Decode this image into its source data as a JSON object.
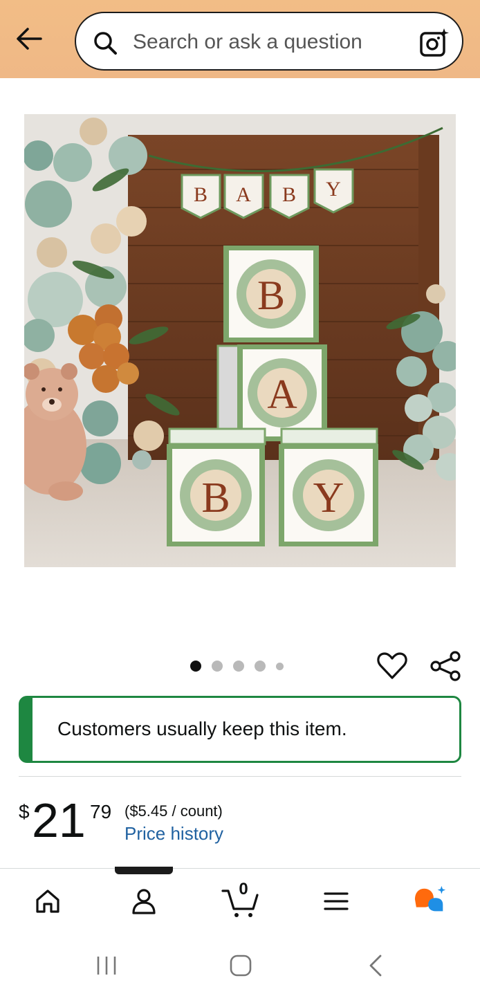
{
  "header": {
    "search_placeholder": "Search or ask a question"
  },
  "carousel": {
    "dot_count": 5,
    "active_index": 0
  },
  "notice": {
    "text": "Customers usually keep this item.",
    "accent_color": "#1e8741"
  },
  "price": {
    "currency": "$",
    "whole": "21",
    "fraction": "79",
    "unit_price": "($5.45 / count)",
    "history_link": "Price history"
  },
  "bottom_nav": {
    "cart_count": "0",
    "items": [
      "home-icon",
      "account-icon",
      "cart-icon",
      "menu-icon",
      "rufus-ai-icon"
    ]
  },
  "product_image": {
    "banner_letters": [
      "B",
      "A",
      "B",
      "Y"
    ],
    "box_letters": [
      "B",
      "A",
      "B",
      "Y"
    ]
  }
}
